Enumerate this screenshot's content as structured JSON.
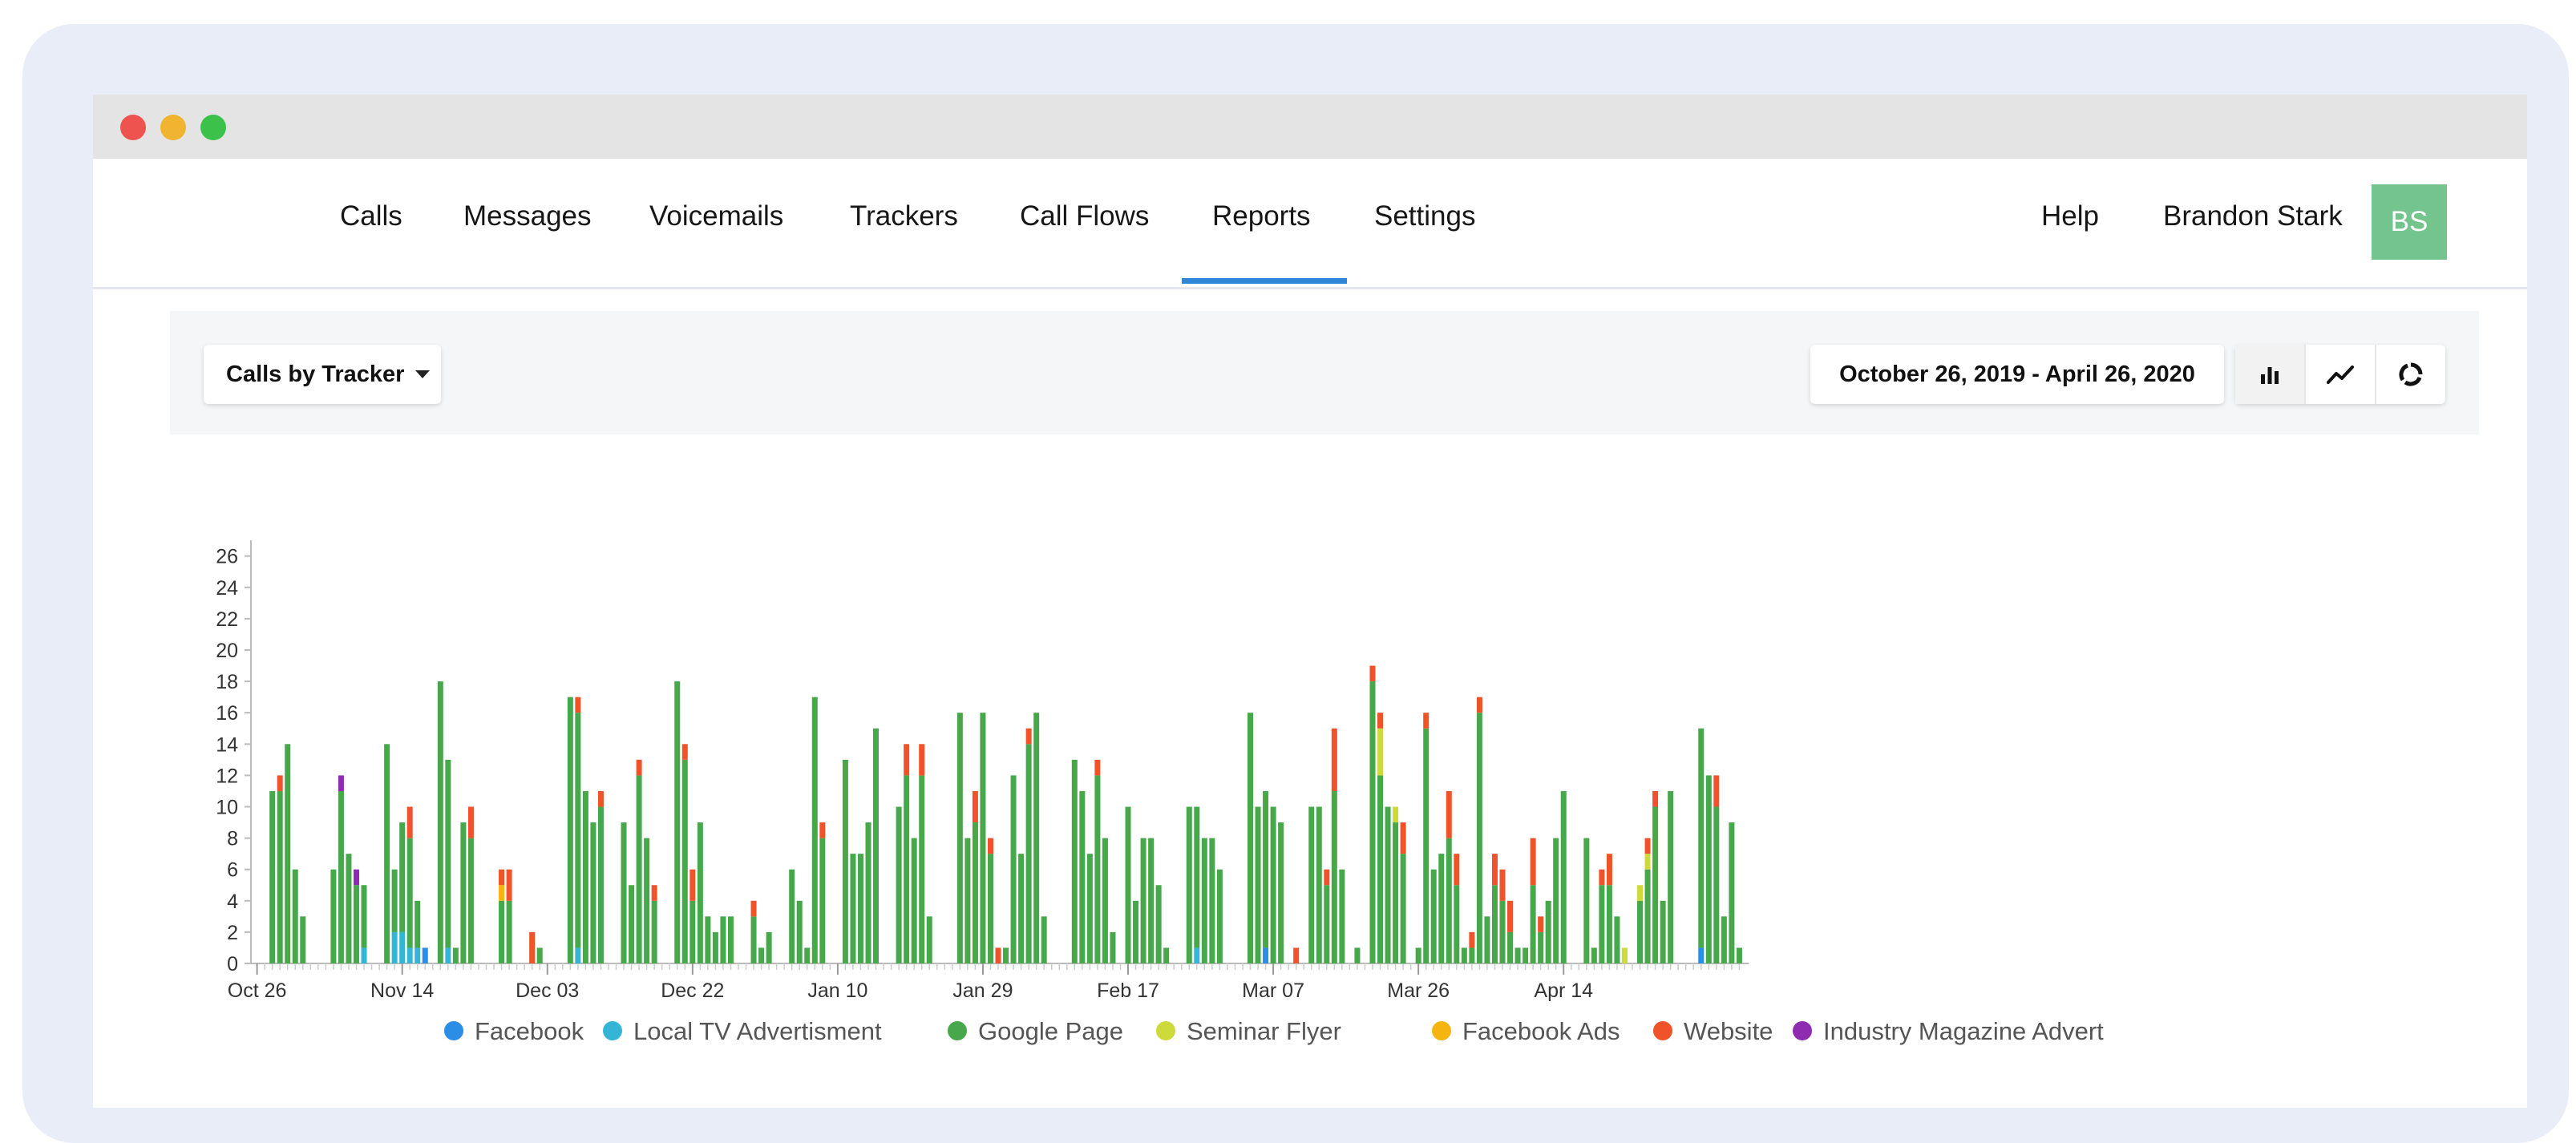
{
  "nav": {
    "items": [
      "Calls",
      "Messages",
      "Voicemails",
      "Trackers",
      "Call Flows",
      "Reports",
      "Settings"
    ],
    "active": "Reports",
    "help": "Help",
    "user_name": "Brandon Stark",
    "avatar_initials": "BS"
  },
  "toolbar": {
    "report_selector": "Calls by Tracker",
    "date_range": "October 26, 2019 - April 26, 2020",
    "chart_type_buttons": [
      "bar-chart-icon",
      "line-chart-icon",
      "donut-chart-icon"
    ],
    "active_chart_type": "bar-chart-icon"
  },
  "colors": {
    "accent": "#2f86d8",
    "avatar": "#74c48e"
  },
  "chart_data": {
    "type": "bar",
    "stacked": true,
    "x_tick_labels": [
      "Oct 26",
      "Nov 14",
      "Dec 03",
      "Dec 22",
      "Jan 10",
      "Jan 29",
      "Feb 17",
      "Mar 07",
      "Mar 26",
      "Apr 14"
    ],
    "ylim": [
      0,
      27
    ],
    "y_ticks": [
      0,
      2,
      4,
      6,
      8,
      10,
      12,
      14,
      16,
      18,
      20,
      22,
      24,
      26
    ],
    "legend_position": "bottom",
    "grid": false,
    "series": [
      {
        "name": "Facebook",
        "color": "#2b8ee6"
      },
      {
        "name": "Local TV Advertisment",
        "color": "#35b5d6"
      },
      {
        "name": "Google Page",
        "color": "#47a84b"
      },
      {
        "name": "Seminar Flyer",
        "color": "#cdda3a"
      },
      {
        "name": "Facebook Ads",
        "color": "#f5b50e"
      },
      {
        "name": "Website",
        "color": "#f0522a"
      },
      {
        "name": "Industry Magazine Advert",
        "color": "#8f2bb0"
      }
    ],
    "first_date": "2019-10-26",
    "days": [
      {
        "G": 0
      },
      {
        "G": 0
      },
      {
        "G": 11
      },
      {
        "G": 11,
        "W": 1
      },
      {
        "G": 14
      },
      {
        "G": 6
      },
      {
        "G": 3
      },
      {
        "G": 0
      },
      {
        "G": 0
      },
      {
        "G": 0
      },
      {
        "G": 6
      },
      {
        "G": 11,
        "I": 1
      },
      {
        "G": 7
      },
      {
        "G": 5,
        "I": 1
      },
      {
        "G": 4,
        "L": 1
      },
      {
        "G": 0
      },
      {
        "G": 0
      },
      {
        "G": 14
      },
      {
        "G": 4,
        "L": 2
      },
      {
        "G": 7,
        "L": 2
      },
      {
        "G": 7,
        "L": 1,
        "W": 2
      },
      {
        "G": 3,
        "L": 1
      },
      {
        "F": 1
      },
      {
        "G": 0
      },
      {
        "G": 18
      },
      {
        "G": 12,
        "L": 1
      },
      {
        "G": 1
      },
      {
        "G": 9
      },
      {
        "G": 8,
        "W": 2
      },
      {
        "G": 0
      },
      {
        "G": 0
      },
      {
        "G": 0
      },
      {
        "G": 4,
        "A": 1,
        "W": 1
      },
      {
        "G": 4,
        "W": 2
      },
      {
        "G": 0
      },
      {
        "G": 0
      },
      {
        "W": 2
      },
      {
        "G": 1
      },
      {
        "G": 0
      },
      {
        "G": 0
      },
      {
        "G": 0
      },
      {
        "G": 17
      },
      {
        "G": 15,
        "L": 1,
        "W": 1
      },
      {
        "G": 11
      },
      {
        "G": 9
      },
      {
        "G": 10,
        "W": 1
      },
      {
        "G": 0
      },
      {
        "G": 0
      },
      {
        "G": 9
      },
      {
        "G": 5
      },
      {
        "G": 12,
        "W": 1
      },
      {
        "G": 8
      },
      {
        "G": 4,
        "W": 1
      },
      {
        "G": 0
      },
      {
        "G": 0
      },
      {
        "G": 18
      },
      {
        "G": 13,
        "W": 1
      },
      {
        "G": 4,
        "W": 2
      },
      {
        "G": 9
      },
      {
        "G": 3
      },
      {
        "G": 2
      },
      {
        "G": 3
      },
      {
        "G": 3
      },
      {
        "G": 0
      },
      {
        "G": 0
      },
      {
        "G": 3,
        "W": 1
      },
      {
        "G": 1
      },
      {
        "G": 2
      },
      {
        "G": 0
      },
      {
        "G": 0
      },
      {
        "G": 6
      },
      {
        "G": 4
      },
      {
        "G": 1
      },
      {
        "G": 17
      },
      {
        "G": 8,
        "W": 1
      },
      {
        "G": 0
      },
      {
        "G": 0
      },
      {
        "G": 13
      },
      {
        "G": 7
      },
      {
        "G": 7
      },
      {
        "G": 9
      },
      {
        "G": 15
      },
      {
        "G": 0
      },
      {
        "G": 0
      },
      {
        "G": 10
      },
      {
        "G": 12,
        "W": 2
      },
      {
        "G": 8
      },
      {
        "G": 12,
        "W": 2
      },
      {
        "G": 3
      },
      {
        "G": 0
      },
      {
        "G": 0
      },
      {
        "G": 0
      },
      {
        "G": 16
      },
      {
        "G": 8
      },
      {
        "G": 9,
        "W": 2
      },
      {
        "G": 16
      },
      {
        "G": 7,
        "W": 1
      },
      {
        "G": 0,
        "W": 1
      },
      {
        "G": 1
      },
      {
        "G": 12
      },
      {
        "G": 7
      },
      {
        "G": 14,
        "W": 1
      },
      {
        "G": 16
      },
      {
        "G": 3
      },
      {
        "G": 0
      },
      {
        "G": 0
      },
      {
        "G": 0
      },
      {
        "G": 13
      },
      {
        "G": 11
      },
      {
        "G": 7
      },
      {
        "G": 12,
        "W": 1
      },
      {
        "G": 8
      },
      {
        "G": 2
      },
      {
        "G": 0
      },
      {
        "G": 10
      },
      {
        "G": 4
      },
      {
        "G": 8
      },
      {
        "G": 8
      },
      {
        "G": 5
      },
      {
        "G": 1
      },
      {
        "G": 0
      },
      {
        "G": 0
      },
      {
        "G": 10
      },
      {
        "G": 9,
        "L": 1
      },
      {
        "G": 8
      },
      {
        "G": 8
      },
      {
        "G": 6
      },
      {
        "G": 0
      },
      {
        "G": 0
      },
      {
        "G": 0
      },
      {
        "G": 16
      },
      {
        "G": 10
      },
      {
        "G": 10,
        "F": 1
      },
      {
        "G": 10
      },
      {
        "G": 9
      },
      {
        "G": 0
      },
      {
        "W": 1
      },
      {
        "G": 0
      },
      {
        "G": 10
      },
      {
        "G": 10
      },
      {
        "G": 5,
        "W": 1
      },
      {
        "G": 11,
        "W": 4
      },
      {
        "G": 6
      },
      {
        "G": 0
      },
      {
        "G": 1
      },
      {
        "G": 0
      },
      {
        "G": 18,
        "W": 1
      },
      {
        "G": 12,
        "S": 3,
        "W": 1
      },
      {
        "G": 10
      },
      {
        "G": 9,
        "S": 1
      },
      {
        "G": 7,
        "W": 2
      },
      {
        "G": 0
      },
      {
        "G": 1
      },
      {
        "G": 15,
        "W": 1
      },
      {
        "G": 6
      },
      {
        "G": 7
      },
      {
        "G": 8,
        "W": 3
      },
      {
        "G": 5,
        "W": 2
      },
      {
        "G": 1
      },
      {
        "G": 1,
        "W": 1
      },
      {
        "G": 16,
        "W": 1
      },
      {
        "G": 3
      },
      {
        "G": 5,
        "W": 2
      },
      {
        "G": 4,
        "W": 2
      },
      {
        "G": 2,
        "W": 2
      },
      {
        "G": 1
      },
      {
        "G": 1
      },
      {
        "G": 5,
        "W": 3
      },
      {
        "G": 2,
        "W": 1
      },
      {
        "G": 4
      },
      {
        "G": 8
      },
      {
        "G": 11
      },
      {
        "G": 0
      },
      {
        "G": 0
      },
      {
        "G": 8
      },
      {
        "G": 1
      },
      {
        "G": 5,
        "W": 1
      },
      {
        "G": 5,
        "W": 2
      },
      {
        "G": 3
      },
      {
        "S": 1
      },
      {
        "G": 0
      },
      {
        "G": 4,
        "S": 1
      },
      {
        "G": 6,
        "S": 1,
        "W": 1
      },
      {
        "G": 10,
        "W": 1
      },
      {
        "G": 4
      },
      {
        "G": 11
      },
      {
        "G": 0
      },
      {
        "G": 0
      },
      {
        "G": 0
      },
      {
        "G": 14,
        "F": 1
      },
      {
        "G": 12
      },
      {
        "G": 10,
        "W": 2
      },
      {
        "G": 3
      },
      {
        "G": 9
      },
      {
        "G": 1
      }
    ]
  }
}
